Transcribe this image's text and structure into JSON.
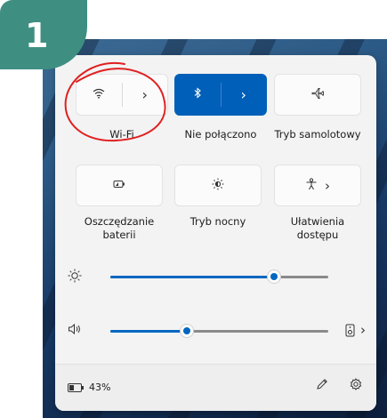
{
  "step_badge": "1",
  "quick_settings": {
    "tiles": [
      {
        "id": "wifi",
        "label": "Wi-Fi",
        "icon": "wifi-icon",
        "arrow": "›",
        "active": false
      },
      {
        "id": "bluetooth",
        "label": "Nie połączono",
        "icon": "bluetooth-icon",
        "arrow": "›",
        "active": true
      },
      {
        "id": "airplane",
        "label": "Tryb samolotowy",
        "icon": "airplane-icon",
        "active": false
      },
      {
        "id": "battery_saver",
        "label_line1": "Oszczędzanie",
        "label_line2": "baterii",
        "icon": "battery-saver-icon",
        "active": false
      },
      {
        "id": "night_light",
        "label": "Tryb nocny",
        "icon": "night-light-icon",
        "active": false
      },
      {
        "id": "accessibility",
        "label_line1": "Ułatwienia",
        "label_line2": "dostępu",
        "icon": "accessibility-icon",
        "arrow": "›",
        "active": false
      }
    ],
    "brightness": {
      "icon": "brightness-icon",
      "level": 0.75
    },
    "volume": {
      "icon": "speaker-icon",
      "level": 0.35,
      "output_icon": "audio-output-icon",
      "arrow": "›"
    },
    "footer": {
      "battery_percent": "43%",
      "edit_icon": "pencil-icon",
      "settings_icon": "gear-icon"
    }
  },
  "colors": {
    "accent": "#005fb8",
    "annotation": "#e02020",
    "badge": "#3e8f82"
  }
}
